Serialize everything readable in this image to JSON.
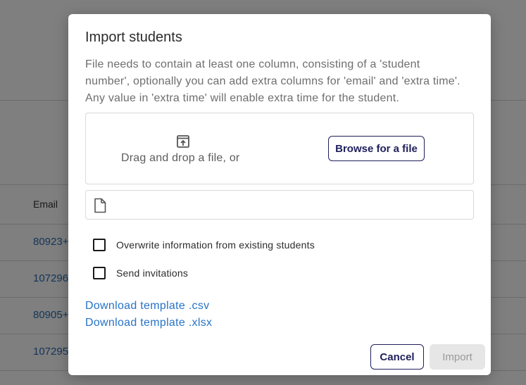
{
  "background": {
    "table_header_email": "Email",
    "rows": [
      "80923+",
      "107296",
      "80905+",
      "107295"
    ]
  },
  "modal": {
    "title": "Import students",
    "description": "File needs to contain at least one column, consisting of a 'student number', optionally you can add extra columns for 'email' and 'extra time'. Any value in 'extra time' will enable extra time for the student.",
    "dropzone": {
      "icon": "upload-file-icon",
      "text": "Drag and drop a file, or",
      "browse_label": "Browse for a file"
    },
    "file_field": {
      "icon": "file-icon",
      "value": ""
    },
    "options": {
      "overwrite_label": "Overwrite information from existing students",
      "overwrite_checked": false,
      "invite_label": "Send invitations",
      "invite_checked": false
    },
    "links": {
      "csv": "Download template .csv",
      "xlsx": "Download template .xlsx"
    },
    "actions": {
      "cancel_label": "Cancel",
      "import_label": "Import",
      "import_disabled": true
    }
  },
  "colors": {
    "accent": "#1f1f5c",
    "link": "#2673c7",
    "overlay": "rgba(0,0,0,0.5)"
  }
}
